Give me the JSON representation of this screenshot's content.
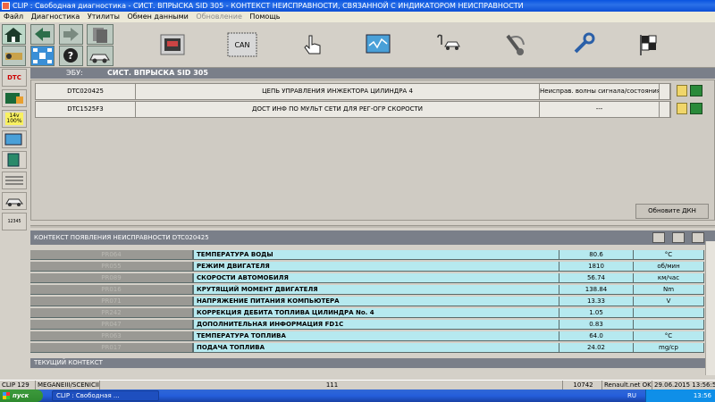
{
  "window": {
    "title": "CLIP : Свободная диагностика - СИСТ. ВПРЫСКА SID 305 - КОНТЕКСТ НЕИСПРАВНОСТИ, СВЯЗАННОЙ С ИНДИКАТОРОМ НЕИСПРАВНОСТИ"
  },
  "menu": {
    "items": [
      "Файл",
      "Диагностика",
      "Утилиты",
      "Обмен данными"
    ],
    "disabled_item": "Обновление",
    "help": "Помощь"
  },
  "toolbar": {
    "can_label": "CAN"
  },
  "sidebar": {
    "dtc_label": "DTC",
    "battery_label": "14v 100%",
    "counter_label": "12345"
  },
  "ecu": {
    "label": "ЭБУ:",
    "name": "СИСТ. ВПРЫСКА SID 305"
  },
  "dtc_list": [
    {
      "code": "DTC020425",
      "description": "ЦЕПЬ УПРАВЛЕНИЯ ИНЖЕКТОРА ЦИЛИНДРА 4",
      "status": "Неиспрaв. волны сигнала/состояния"
    },
    {
      "code": "DTC1525F3",
      "description": "ДОСТ ИНФ ПО МУЛЬТ СЕТИ ДЛЯ РЕГ-ОГР СКОРОСТИ",
      "status": "---"
    }
  ],
  "refresh_button": "Обновите ДКН",
  "context": {
    "header": "КОНТЕКСТ ПОЯВЛЕНИЯ НЕИСПРАВНОСТИ DTC020425",
    "rows": [
      {
        "code": "PR064",
        "name": "ТЕМПЕРАТУРА ВОДЫ",
        "value": "80.6",
        "unit": "°C"
      },
      {
        "code": "PR055",
        "name": "РЕЖИМ ДВИГАТЕЛЯ",
        "value": "1810",
        "unit": "об/мин"
      },
      {
        "code": "PR089",
        "name": "СКОРОСТИ АВТОМОБИЛЯ",
        "value": "56.74",
        "unit": "км/час"
      },
      {
        "code": "PR016",
        "name": "КРУТЯЩИЙ МОМЕНТ ДВИГАТЕЛЯ",
        "value": "138.84",
        "unit": "Nm"
      },
      {
        "code": "PR071",
        "name": "НАПРЯЖЕНИЕ ПИТАНИЯ КОМПЬЮТЕРА",
        "value": "13.33",
        "unit": "V"
      },
      {
        "code": "PR242",
        "name": "КОРРЕКЦИЯ ДЕБИТА ТОПЛИВА ЦИЛИНДРА No. 4",
        "value": "1.05",
        "unit": ""
      },
      {
        "code": "PR047",
        "name": "ДОПОЛНИТЕЛЬНАЯ ИНФОРМАЦИЯ FD1C",
        "value": "0.83",
        "unit": ""
      },
      {
        "code": "PR063",
        "name": "ТЕМПЕРАТУРА ТОПЛИВА",
        "value": "64.0",
        "unit": "°C"
      },
      {
        "code": "PR017",
        "name": "ПОДАЧА ТОПЛИВА",
        "value": "24.02",
        "unit": "mg/cp"
      }
    ]
  },
  "current_context": {
    "header": "ТЕКУЩИЙ КОНТЕКСТ"
  },
  "status_bar": {
    "clip": "CLIP 129",
    "vehicle": "MEGANEIII/SCENICIII",
    "center": "111",
    "code": "10742",
    "network": "Renault.net OK",
    "datetime": "29.06.2015 13:56:52"
  },
  "taskbar": {
    "start": "пуск",
    "task": "CLIP : Свободная ...",
    "lang": "RU",
    "clock": "13:56"
  }
}
